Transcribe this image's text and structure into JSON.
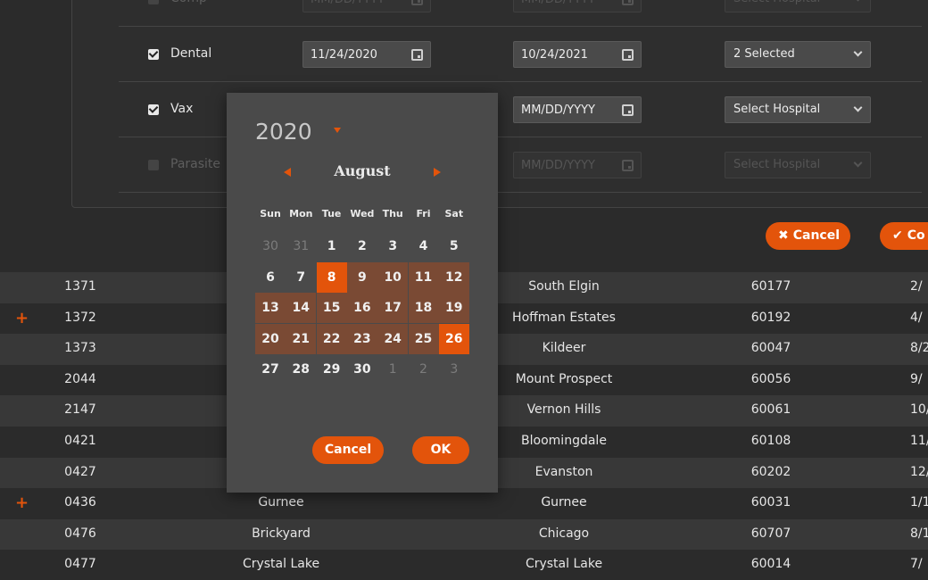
{
  "form": {
    "rows": [
      {
        "label": "Comp",
        "checked": false,
        "disabled": true,
        "start": "MM/DD/YYYY",
        "end": "MM/DD/YYYY",
        "hospital": "Select Hospital"
      },
      {
        "label": "Dental",
        "checked": true,
        "disabled": false,
        "start": "11/24/2020",
        "end": "10/24/2021",
        "hospital": "2 Selected"
      },
      {
        "label": "Vax",
        "checked": true,
        "disabled": false,
        "start": "",
        "end": "MM/DD/YYYY",
        "hospital": "Select Hospital"
      },
      {
        "label": "Parasite",
        "checked": false,
        "disabled": true,
        "start": "",
        "end": "MM/DD/YYYY",
        "hospital": "Select Hospital"
      }
    ]
  },
  "actions": {
    "cancel_label": "Cancel",
    "confirm_label": "Co"
  },
  "table": {
    "rows": [
      {
        "id": "1371",
        "name": "",
        "city": "South Elgin",
        "zip": "60177",
        "date": "2/",
        "plus": false
      },
      {
        "id": "1372",
        "name": "",
        "city": "Hoffman Estates",
        "zip": "60192",
        "date": "4/",
        "plus": true
      },
      {
        "id": "1373",
        "name": "",
        "city": "Kildeer",
        "zip": "60047",
        "date": "8/2",
        "plus": false
      },
      {
        "id": "2044",
        "name": "",
        "city": "Mount Prospect",
        "zip": "60056",
        "date": "9/",
        "plus": false
      },
      {
        "id": "2147",
        "name": "",
        "city": "Vernon Hills",
        "zip": "60061",
        "date": "10/",
        "plus": false
      },
      {
        "id": "0421",
        "name": "",
        "city": "Bloomingdale",
        "zip": "60108",
        "date": "11/",
        "plus": false
      },
      {
        "id": "0427",
        "name": "",
        "city": "Evanston",
        "zip": "60202",
        "date": "12/",
        "plus": false
      },
      {
        "id": "0436",
        "name": "Gurnee",
        "city": "Gurnee",
        "zip": "60031",
        "date": "1/1",
        "plus": true
      },
      {
        "id": "0476",
        "name": "Brickyard",
        "city": "Chicago",
        "zip": "60707",
        "date": "8/1",
        "plus": false
      },
      {
        "id": "0477",
        "name": "Crystal Lake",
        "city": "Crystal Lake",
        "zip": "60014",
        "date": "7/",
        "plus": false
      }
    ]
  },
  "picker": {
    "year": "2020",
    "month": "August",
    "weekdays": [
      "Sun",
      "Mon",
      "Tue",
      "Wed",
      "Thu",
      "Fri",
      "Sat"
    ],
    "weeks": [
      [
        "30",
        "31",
        "1",
        "2",
        "3",
        "4",
        "5"
      ],
      [
        "6",
        "7",
        "8",
        "9",
        "10",
        "11",
        "12"
      ],
      [
        "13",
        "14",
        "15",
        "16",
        "17",
        "18",
        "19"
      ],
      [
        "20",
        "21",
        "22",
        "23",
        "24",
        "25",
        "26"
      ],
      [
        "27",
        "28",
        "29",
        "30",
        "1",
        "2",
        "3"
      ]
    ],
    "range_start": "8",
    "range_end": "26",
    "cancel_label": "Cancel",
    "ok_label": "OK"
  },
  "colors": {
    "accent": "#e3540b",
    "range": "#7a4a34",
    "background": "#2b2b2b",
    "row_alt": "#383838"
  }
}
